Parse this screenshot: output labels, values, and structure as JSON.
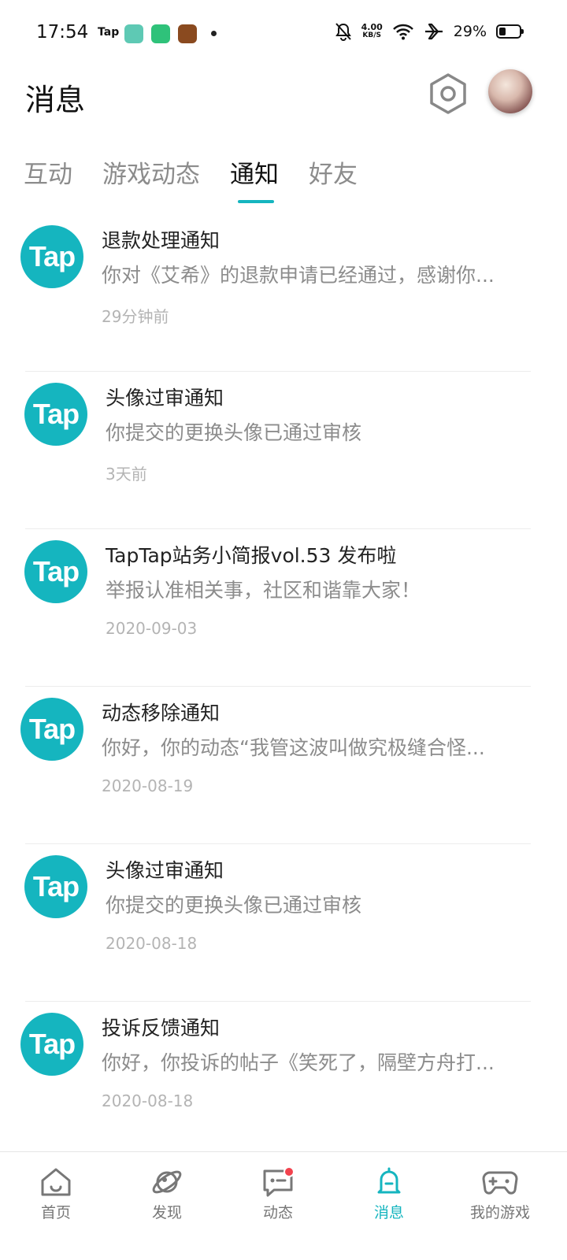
{
  "status_bar": {
    "time": "17:54",
    "tap_label": "Tap",
    "net_speed_value": "4.00",
    "net_speed_unit": "KB/S",
    "battery": "29%",
    "icons": [
      "bell-muted-icon",
      "wifi-icon",
      "airplane-icon",
      "battery-icon"
    ]
  },
  "header": {
    "title": "消息",
    "settings_icon": "hexagon-gear-icon"
  },
  "tabs": [
    {
      "label": "互动",
      "active": false
    },
    {
      "label": "游戏动态",
      "active": false
    },
    {
      "label": "通知",
      "active": true
    },
    {
      "label": "好友",
      "active": false
    }
  ],
  "notices": [
    {
      "logo": "Tap",
      "title": "退款处理通知",
      "body": "你对《艾希》的退款申请已经通过，感谢你...",
      "time": "29分钟前"
    },
    {
      "logo": "Tap",
      "title": "头像过审通知",
      "body": "你提交的更换头像已通过审核",
      "time": "3天前"
    },
    {
      "logo": "Tap",
      "title": "TapTap站务小简报vol.53 发布啦",
      "body": "举报认准相关事，社区和谐靠大家！",
      "time": "2020-09-03"
    },
    {
      "logo": "Tap",
      "title": "动态移除通知",
      "body": "你好，你的动态“我管这波叫做究极缝合怪...",
      "time": "2020-08-19"
    },
    {
      "logo": "Tap",
      "title": "头像过审通知",
      "body": "你提交的更换头像已通过审核",
      "time": "2020-08-18"
    },
    {
      "logo": "Tap",
      "title": "投诉反馈通知",
      "body": "你好，你投诉的帖子《笑死了，隔壁方舟打...",
      "time": "2020-08-18"
    }
  ],
  "bottom_nav": [
    {
      "label": "首页",
      "icon": "home-icon",
      "active": false
    },
    {
      "label": "发现",
      "icon": "planet-icon",
      "active": false
    },
    {
      "label": "动态",
      "icon": "chat-icon",
      "active": false,
      "badge": true
    },
    {
      "label": "消息",
      "icon": "bell-icon",
      "active": true
    },
    {
      "label": "我的游戏",
      "icon": "gamepad-icon",
      "active": false
    }
  ],
  "colors": {
    "accent": "#15b5bf",
    "badge": "#f2424d"
  }
}
